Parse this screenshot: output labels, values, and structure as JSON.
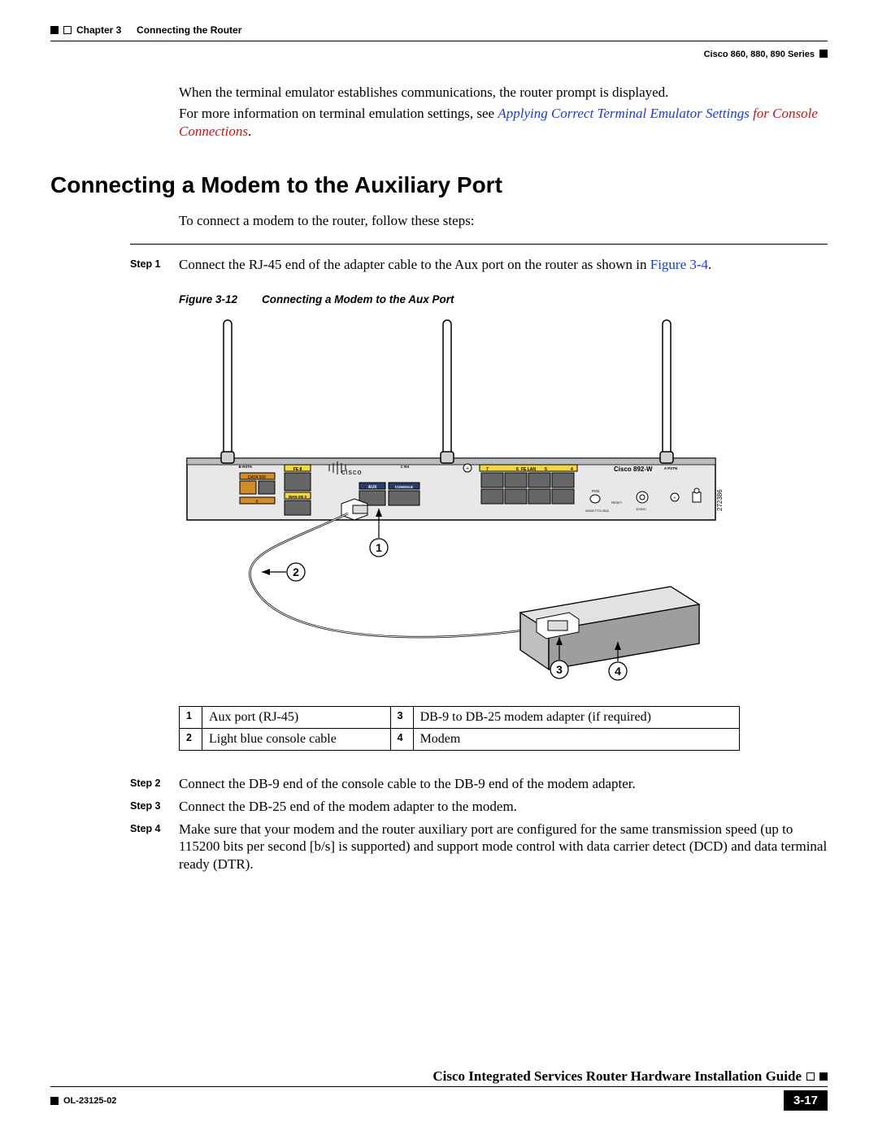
{
  "header": {
    "chapter": "Chapter 3",
    "chapter_title": "Connecting the Router",
    "series": "Cisco 860, 880, 890 Series"
  },
  "intro_paras": {
    "p1": "When the terminal emulator establishes communications, the router prompt is displayed.",
    "p2_a": "For more information on terminal emulation settings, see ",
    "p2_link_blue": "Applying Correct Terminal Emulator Settings ",
    "p2_link_red": "for Console Connections"
  },
  "section_title": "Connecting a Modem to the Auxiliary Port",
  "section_intro": "To connect a modem to the router, follow these steps:",
  "steps": {
    "s1_label": "Step 1",
    "s1_text_a": "Connect the RJ-45 end of the adapter cable to the Aux port on the router as shown in ",
    "s1_link": "Figure 3-4",
    "s1_text_b": ".",
    "s2_label": "Step 2",
    "s2_text": "Connect the DB-9 end of the console cable to the DB-9 end of the modem adapter.",
    "s3_label": "Step 3",
    "s3_text": "Connect the DB-25 end of the modem adapter to the modem.",
    "s4_label": "Step 4",
    "s4_text": "Make sure that your modem and the router auxiliary port are configured for the same transmission speed (up to 115200 bits per second [b/s] is supported) and support mode control with data carrier detect (DCD) and data terminal ready (DTR)."
  },
  "figure": {
    "number": "Figure 3-12",
    "title": "Connecting a Modem to the Aux Port",
    "device_label": "Cisco 892-W",
    "brand": "cisco",
    "drawing_id": "272386",
    "port_labels": {
      "fe8": "FE 8",
      "data": "DATA 900",
      "wan": "WAN GE 0",
      "aux": "AUX",
      "console": "CONSOLE",
      "b_rstk": "B RSTK",
      "c_rx": "C RX",
      "felan_left": "7",
      "felan_right": "4",
      "felan_label": "FE LAN",
      "a_pstn": "A PSTN",
      "poe": "POE",
      "power": "12VDC",
      "reset": "RESET",
      "usb": "4000CTT/1.5DA",
      "six": "6",
      "five": "5"
    },
    "callouts": {
      "c1": "1",
      "c2": "2",
      "c3": "3",
      "c4": "4"
    }
  },
  "legend": {
    "r1c1": "1",
    "r1c2": "Aux port (RJ-45)",
    "r1c3": "3",
    "r1c4": "DB-9 to DB-25 modem adapter (if required)",
    "r2c1": "2",
    "r2c2": "Light blue console cable",
    "r2c3": "4",
    "r2c4": "Modem"
  },
  "footer": {
    "guide": "Cisco Integrated Services Router Hardware Installation Guide",
    "doc": "OL-23125-02",
    "page": "3-17"
  }
}
